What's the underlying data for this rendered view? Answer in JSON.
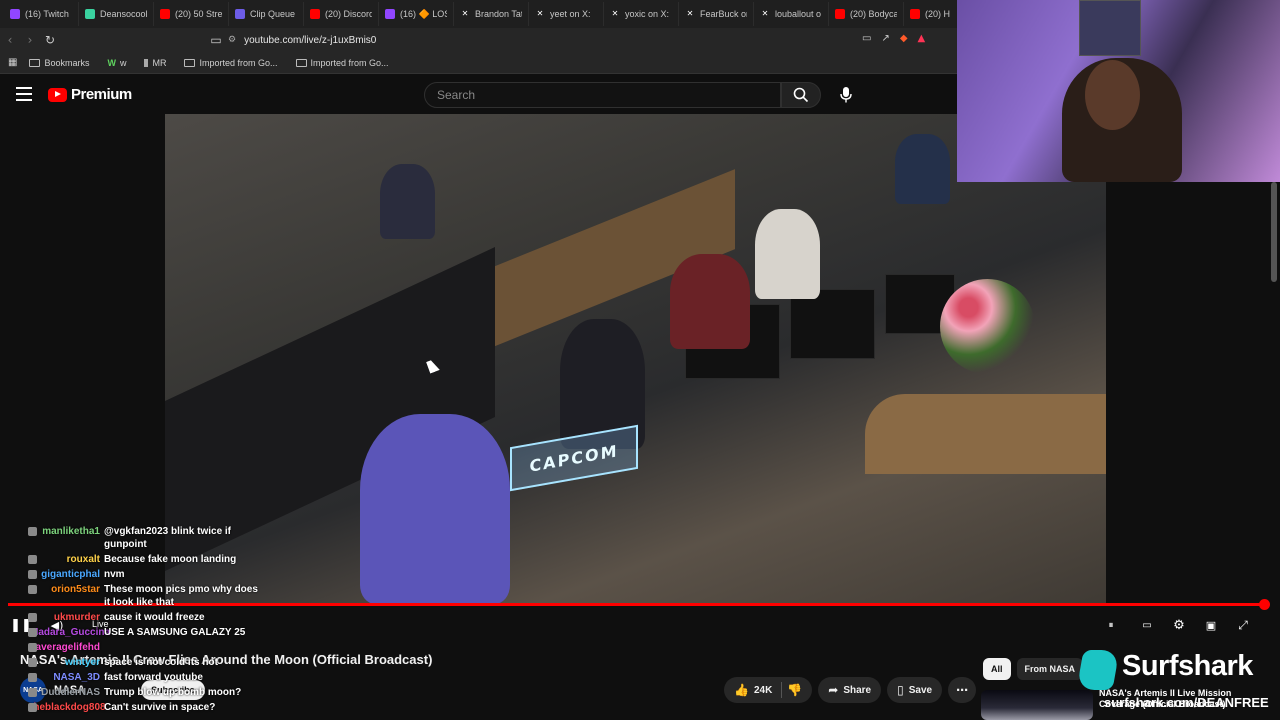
{
  "browser": {
    "tabs": [
      {
        "label": "(16) Twitch",
        "color": "#9146ff",
        "icon": "twitch-icon"
      },
      {
        "label": "Deansocool",
        "color": "#3ad29f",
        "icon": "site-icon"
      },
      {
        "label": "(20) 50 Stre",
        "color": "#ff0000",
        "icon": "youtube-icon"
      },
      {
        "label": "Clip Queue",
        "color": "#6c5ce7",
        "icon": "queue-icon"
      },
      {
        "label": "(20) Discord",
        "color": "#ff0000",
        "icon": "youtube-icon"
      },
      {
        "label": "(16) 🔶 LOS",
        "color": "#9146ff",
        "icon": "twitch-icon"
      },
      {
        "label": "Brandon Tat",
        "color": "#000000",
        "icon": "x-icon"
      },
      {
        "label": "yeet on X:",
        "color": "#000000",
        "icon": "x-icon"
      },
      {
        "label": "yoxic on X:",
        "color": "#000000",
        "icon": "x-icon"
      },
      {
        "label": "FearBuck on",
        "color": "#000000",
        "icon": "x-icon"
      },
      {
        "label": "louballout o",
        "color": "#000000",
        "icon": "x-icon"
      },
      {
        "label": "(20) Bodyca",
        "color": "#ff0000",
        "icon": "youtube-icon"
      },
      {
        "label": "(20) H",
        "color": "#ff0000",
        "icon": "youtube-icon"
      }
    ],
    "url": "youtube.com/live/z-j1uxBmis0",
    "bookmarks": [
      {
        "label": "Bookmarks"
      },
      {
        "label": "w"
      },
      {
        "label": "MR"
      },
      {
        "label": "Imported from Go..."
      },
      {
        "label": "Imported from Go..."
      }
    ]
  },
  "youtube": {
    "logo_text": "Premium",
    "search_placeholder": "Search"
  },
  "video": {
    "capcom_sign": "CAPCOM",
    "progress": 1.0,
    "title": "NASA's Artemis II Crew Flies Around the Moon (Official Broadcast)",
    "channel_name": "NASA",
    "channel_avatar_text": "NASA",
    "subscribe_label": "Subscribe",
    "likes": "24K",
    "share_label": "Share",
    "save_label": "Save",
    "live_label": "Live"
  },
  "sidebar": {
    "chips": [
      "All",
      "From NASA"
    ],
    "reco_title": "NASA's Artemis II Live Mission Coverage (Official Broadcast)"
  },
  "overlay": {
    "sponsor_name": "Surfshark",
    "sponsor_url": "surfshark.com/DEANFREE"
  },
  "chat": [
    {
      "user": "manliketha1",
      "color": "#7dd37d",
      "text": "@vgkfan2023 blink twice if gunpoint"
    },
    {
      "user": "rouxalt",
      "color": "#ffd24a",
      "text": "Because fake moon landing"
    },
    {
      "user": "giganticphal",
      "color": "#4aa8ff",
      "text": "nvm"
    },
    {
      "user": "orion5star",
      "color": "#ff8c1a",
      "text": "These moon pics pmo why does it look like that"
    },
    {
      "user": "ukmurder",
      "color": "#ff4a4a",
      "text": "cause it would freeze"
    },
    {
      "user": "Madara_Guccina",
      "color": "#b54ae0",
      "text": "USE A SAMSUNG GALAZY 25"
    },
    {
      "user": "averagelifehd",
      "color": "#ff4ad2",
      "text": ""
    },
    {
      "user": "wintyer",
      "color": "#4ad2ff",
      "text": "space is not cold its hot"
    },
    {
      "user": "NASA_3D",
      "color": "#7d8cff",
      "text": "fast forward youtube"
    },
    {
      "user": "DuddlerNAS",
      "color": "#9aa0a6",
      "text": "Trump blow up bomb moon?"
    },
    {
      "user": "theblackdog808",
      "color": "#ff4a4a",
      "text": "Can't survive in space?"
    }
  ]
}
